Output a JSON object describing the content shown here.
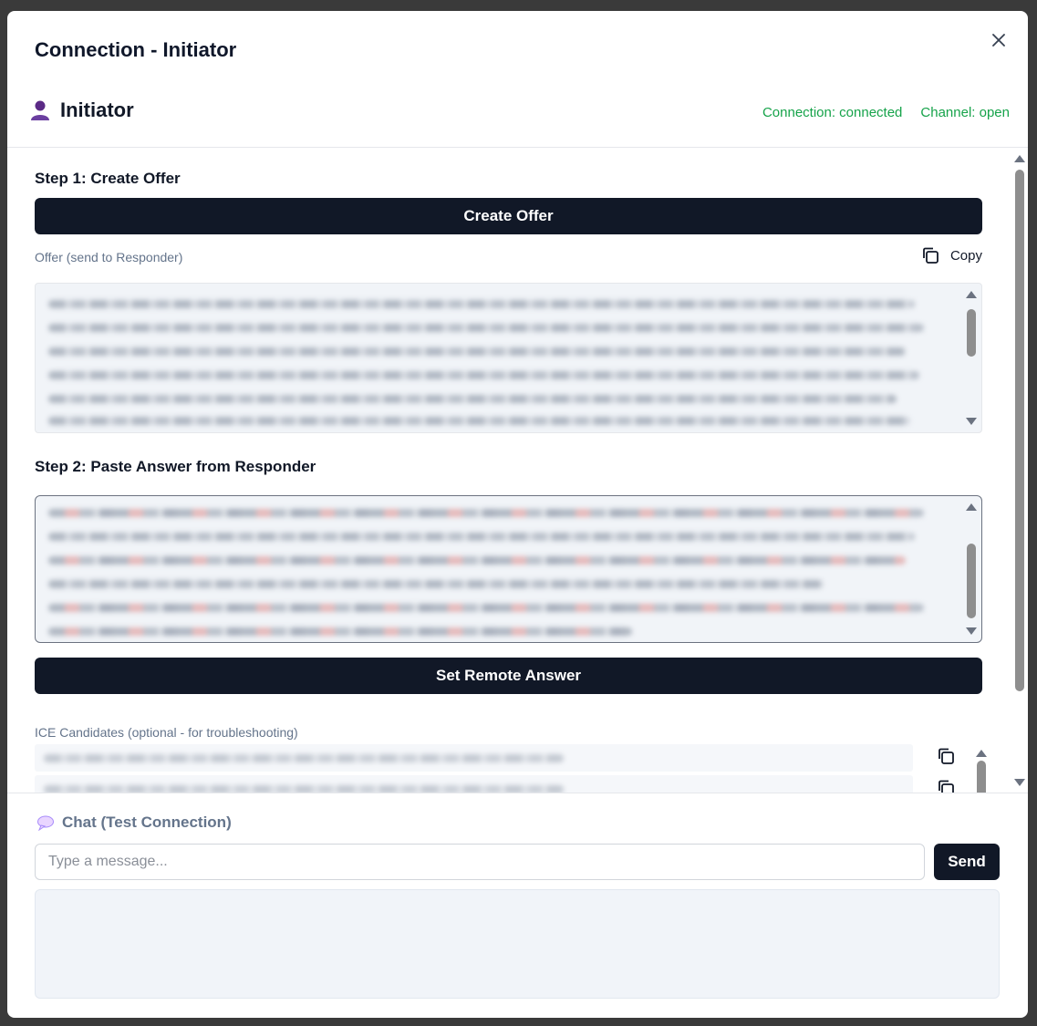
{
  "dialog": {
    "title": "Connection - Initiator",
    "close_icon": "close-icon"
  },
  "role": {
    "icon": "person-icon",
    "label": "Initiator"
  },
  "status": {
    "connection": "Connection: connected",
    "channel": "Channel: open",
    "color": "#16a34a"
  },
  "step1": {
    "title": "Step 1: Create Offer",
    "button_label": "Create Offer",
    "offer_label": "Offer (send to Responder)",
    "copy_label": "Copy",
    "copy_icon": "copy-icon"
  },
  "step2": {
    "title": "Step 2: Paste Answer from Responder",
    "button_label": "Set Remote Answer"
  },
  "ice": {
    "label": "ICE Candidates (optional - for troubleshooting)",
    "copy_icon": "copy-icon"
  },
  "chat": {
    "icon": "speech-bubble-icon",
    "title": "Chat (Test Connection)",
    "input_placeholder": "Type a message...",
    "send_label": "Send"
  },
  "colors": {
    "primary_button": "#111827",
    "status_green": "#16a34a"
  }
}
